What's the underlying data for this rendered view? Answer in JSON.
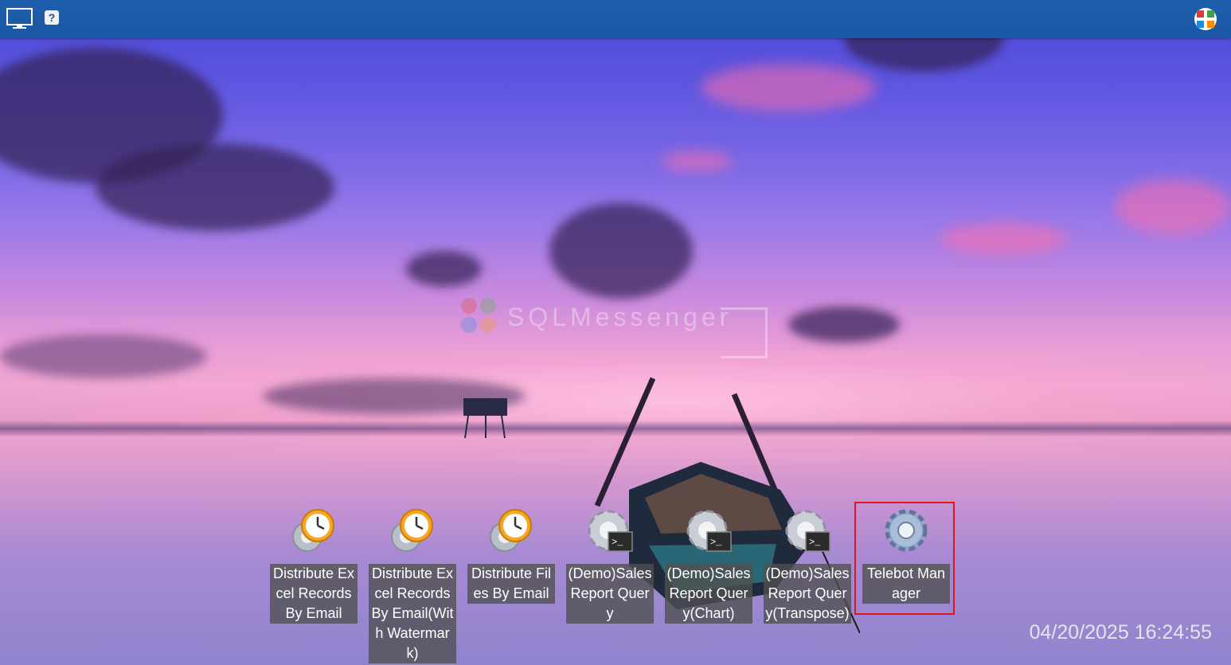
{
  "desktop": {
    "watermark_text": "SQLMessenger",
    "shortcuts": [
      {
        "label": "Distribute Excel Records By Email",
        "icon": "clock-gear-icon"
      },
      {
        "label": "Distribute Excel Records By Email(With Watermark)",
        "icon": "clock-gear-icon"
      },
      {
        "label": "Distribute Files By Email",
        "icon": "clock-gear-icon"
      },
      {
        "label": "(Demo)Sales Report Query",
        "icon": "terminal-gear-icon"
      },
      {
        "label": "(Demo)Sales Report Query(Chart)",
        "icon": "terminal-gear-icon"
      },
      {
        "label": "(Demo)Sales Report Query(Transpose)",
        "icon": "terminal-gear-icon"
      },
      {
        "label": "Telebot Manager",
        "icon": "gear-icon"
      }
    ],
    "selected_shortcut": "Telebot Manager",
    "clock": "04/20/2025 16:24:55"
  },
  "topbar": {
    "help_label": "?",
    "icons": [
      "monitor-icon",
      "help-icon",
      "app-logo-icon"
    ],
    "color": "#1e5fae"
  },
  "colors": {
    "selection_border": "#e0161e",
    "label_background": "#505050"
  }
}
